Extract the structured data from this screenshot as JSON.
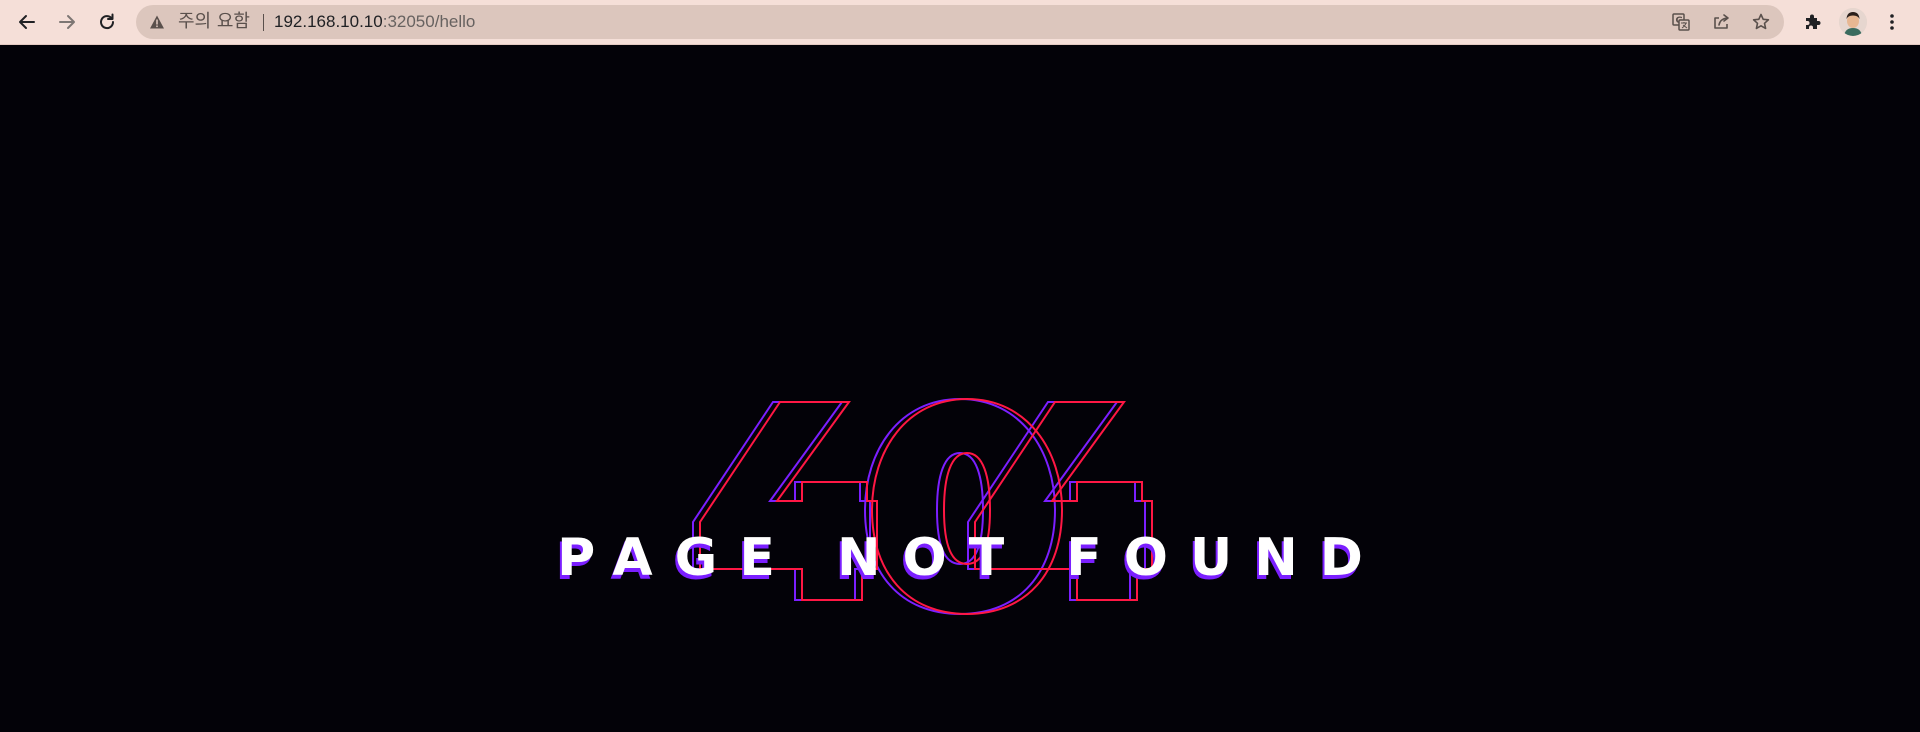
{
  "browser": {
    "security_label": "주의 요함",
    "url_host": "192.168.10.10",
    "url_path": ":32050/hello"
  },
  "page": {
    "big_code": "404",
    "headline": "PAGE NOT FOUND"
  },
  "colors": {
    "toolbar_bg": "#f5dfd8",
    "omnibox_bg": "#dcc6bd",
    "page_bg": "#030208",
    "outline_purple": "#7b1fff",
    "outline_red": "#ff1744",
    "headline_text": "#ffffff"
  },
  "icons": {
    "back": "arrow-left-icon",
    "forward": "arrow-right-icon",
    "reload": "reload-icon",
    "warning": "warning-triangle-icon",
    "translate": "translate-icon",
    "share": "share-icon",
    "bookmark": "star-icon",
    "extensions": "puzzle-icon",
    "profile": "avatar",
    "menu": "kebab-menu-icon"
  }
}
